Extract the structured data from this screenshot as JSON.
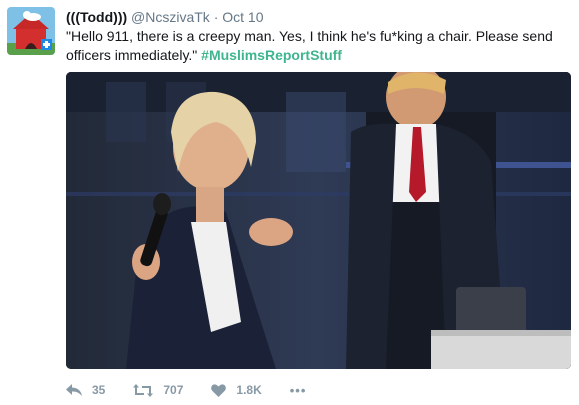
{
  "tweet": {
    "display_name": "(((Todd)))",
    "handle": "@NcszivaTk",
    "separator": "·",
    "time": "Oct 10",
    "text": "\"Hello 911, there is a creepy man. Yes, I think he's fu*king a chair. Please send officers immediately.\"",
    "hashtag": "#MuslimsReportStuff",
    "colors": {
      "hashtag": "#3fb58f",
      "meta": "#657786",
      "action": "#8899a6"
    }
  },
  "actions": {
    "reply": {
      "icon": "reply-icon",
      "count": "35"
    },
    "retweet": {
      "icon": "retweet-icon",
      "count": "707"
    },
    "like": {
      "icon": "heart-icon",
      "count": "1.8K"
    },
    "more": {
      "icon": "more-dots-icon",
      "label": "•••"
    }
  }
}
